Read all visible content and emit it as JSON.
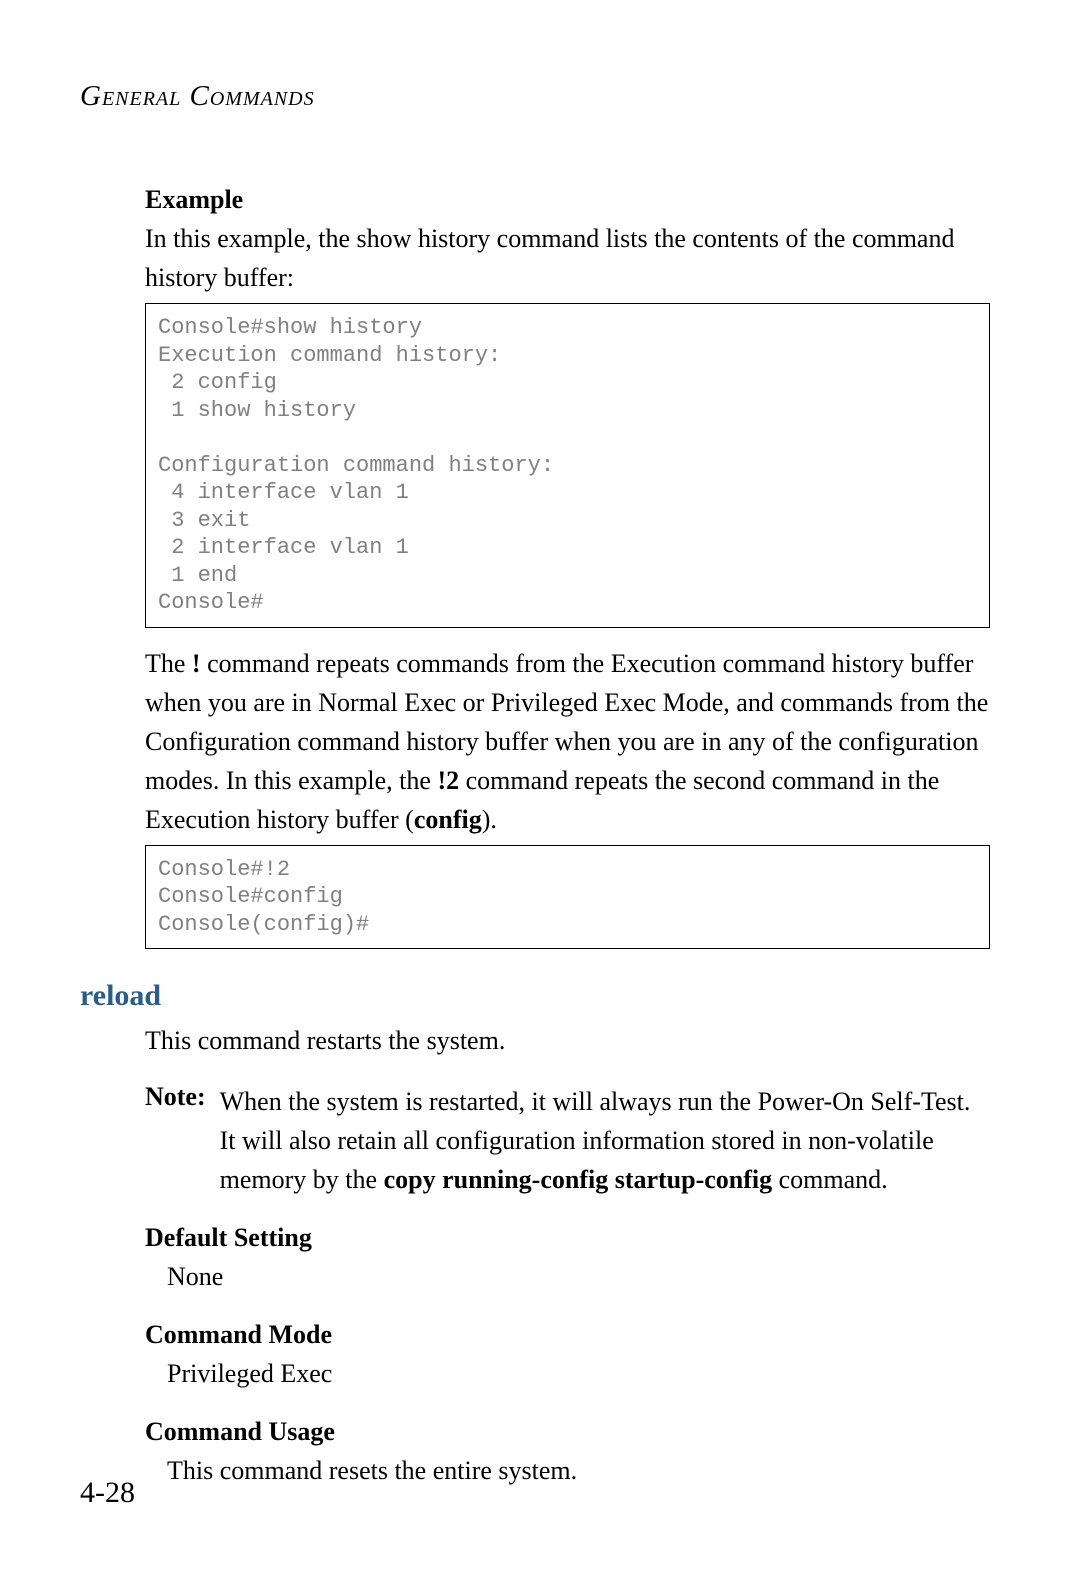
{
  "running_head": "General Commands",
  "example_heading": "Example",
  "example_intro": "In this example, the show history command lists the contents of the command history buffer:",
  "codebox1": "Console#show history\nExecution command history:\n 2 config\n 1 show history\n\nConfiguration command history:\n 4 interface vlan 1\n 3 exit\n 2 interface vlan 1\n 1 end\nConsole#",
  "bang_para_1": "The ",
  "bang_cmd1": "!",
  "bang_para_2": " command repeats commands from the Execution command history buffer when you are in Normal Exec or Privileged Exec Mode, and commands from the Configuration command history buffer when you are in any of the configuration modes. In this example, the ",
  "bang_cmd2": "!2",
  "bang_para_3": " command repeats the second command in the Execution history buffer (",
  "bang_config": "config",
  "bang_para_4": ").",
  "codebox2": "Console#!2\nConsole#config\nConsole(config)#",
  "reload_heading": "reload",
  "reload_intro": "This command restarts the system.",
  "note_label": "Note:",
  "note_body_1": "When the system is restarted, it will always run the Power-On Self-Test. It will also retain all configuration information stored in non-volatile memory by the ",
  "note_cmd": "copy running-config startup-config",
  "note_body_2": " command.",
  "default_heading": "Default Setting",
  "default_value": "None",
  "mode_heading": "Command Mode",
  "mode_value": "Privileged Exec",
  "usage_heading": "Command Usage",
  "usage_value": "This command resets the entire system.",
  "page_number": "4-28"
}
